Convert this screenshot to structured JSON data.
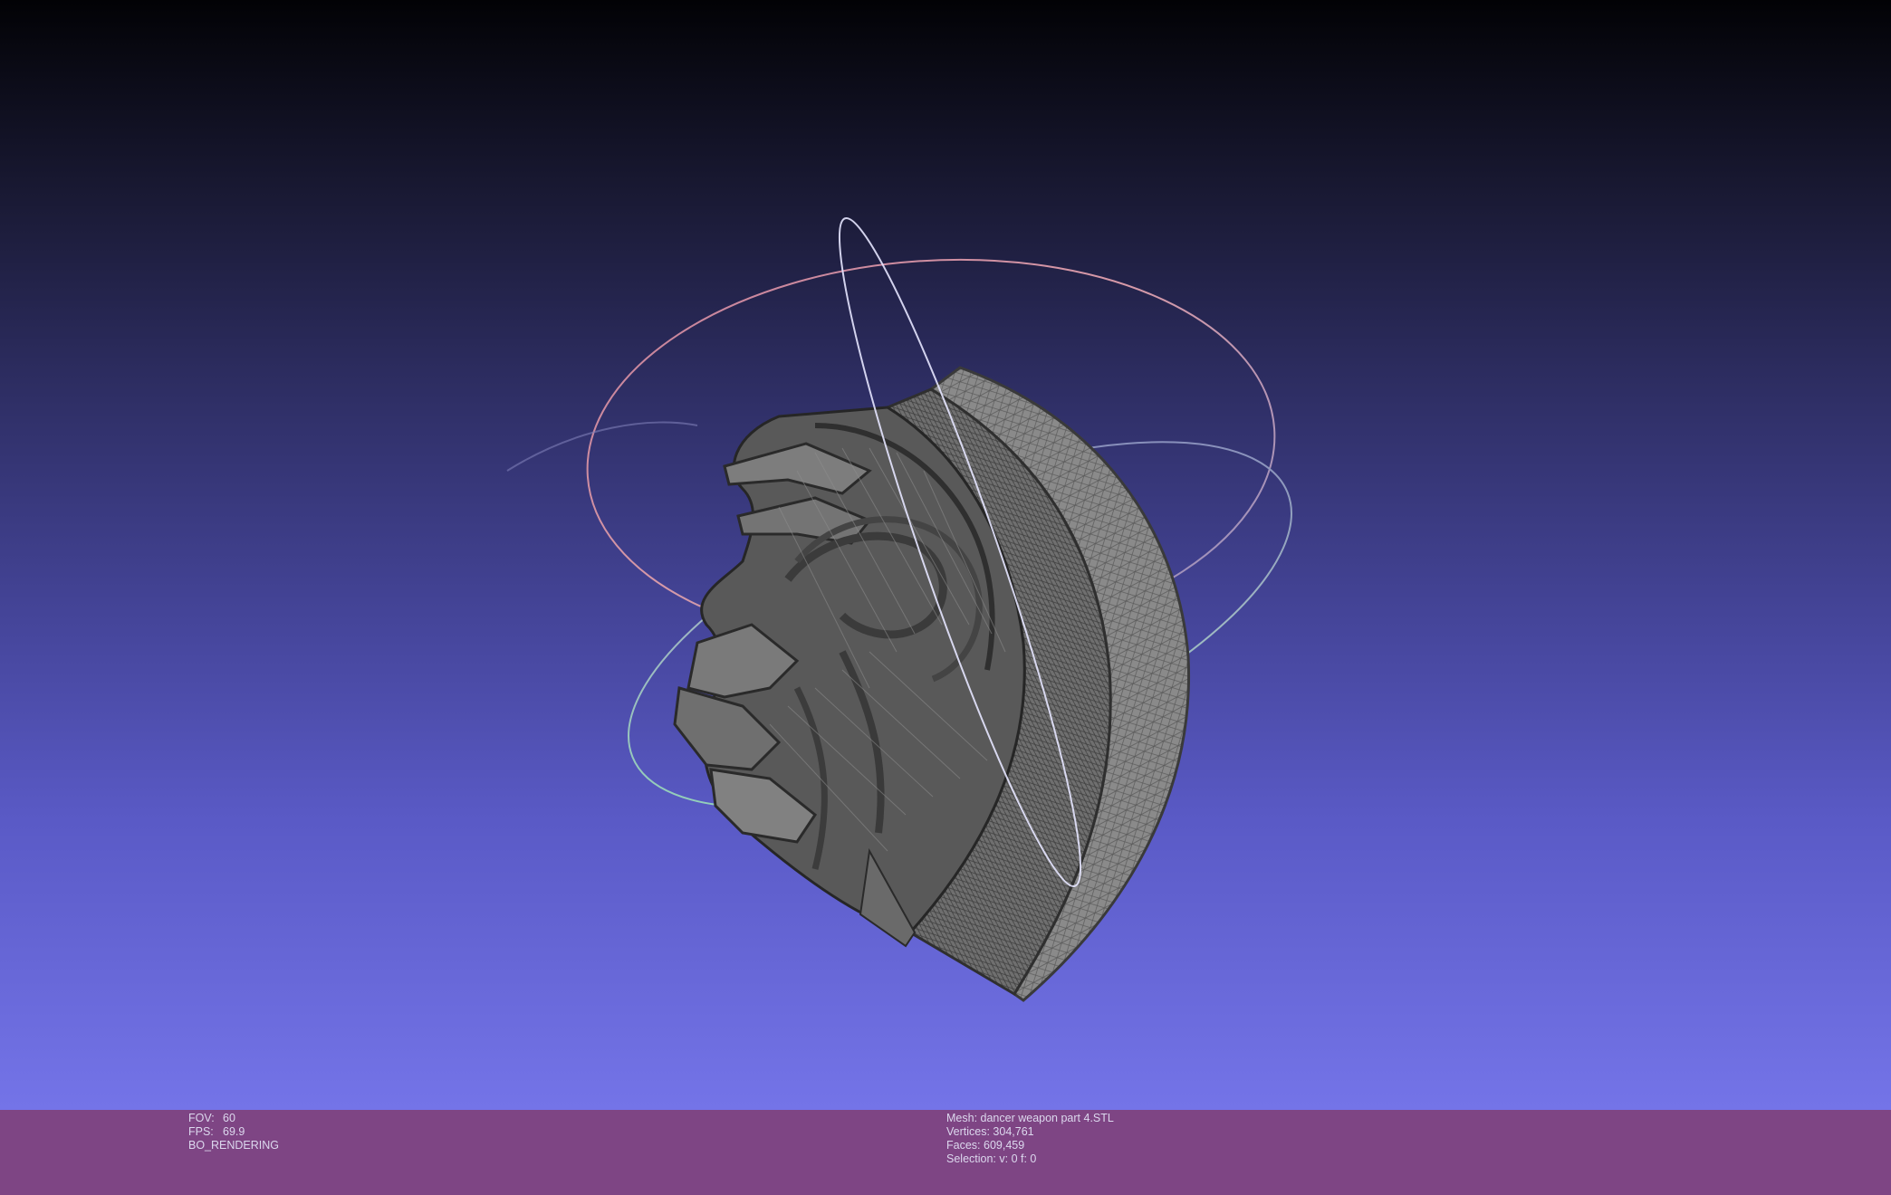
{
  "status_left": {
    "fov_label": "FOV:",
    "fov_value": "60",
    "fps_label": "FPS:",
    "fps_value": "69.9",
    "render_mode": "BO_RENDERING"
  },
  "status_right": {
    "mesh_label": "Mesh:",
    "mesh_name": "dancer weapon part 4.STL",
    "vertices_label": "Vertices:",
    "vertices_value": "304,761",
    "faces_label": "Faces:",
    "faces_value": "609,459",
    "selection_label": "Selection:",
    "selection_value": "v: 0 f: 0"
  },
  "colors": {
    "background_top": "#020205",
    "background_bottom": "#7474e8",
    "info_bar": "#7e4584",
    "mesh": "#7b7b7b",
    "trackball_pink": "#d79aa8",
    "trackball_green": "#8ed9b6",
    "trackball_white": "#e6e6ff"
  }
}
